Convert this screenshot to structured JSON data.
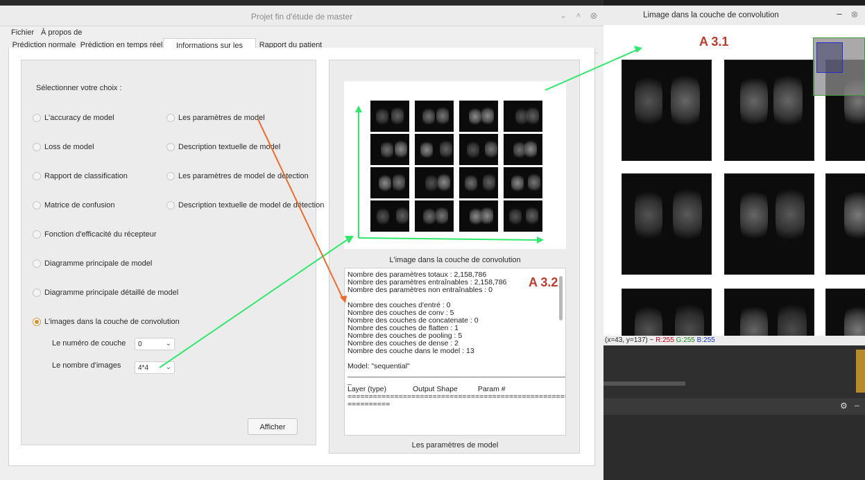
{
  "main_window": {
    "title": "Projet fin d'étude de master",
    "minimize_symbol": "⌄",
    "maximize_symbol": "˄",
    "close_symbol": "⊗",
    "menu": [
      "Fichier",
      "À propos de"
    ],
    "tabs": [
      "Prédiction normale",
      "Prédiction en temps réel",
      "Informations sur les modeles",
      "Rapport du patient"
    ],
    "active_tab_index": 2
  },
  "left_panel": {
    "prompt": "Sélectionner votre choix :",
    "options_col1": [
      "L'accuracy de model",
      "Loss de model",
      "Rapport de classification",
      "Matrice de confusion",
      "Fonction d'efficacité du récepteur",
      "Diagramme principale de model",
      "Diagramme principale détaillé de  model",
      "L'images dans la couche de convolution"
    ],
    "options_col2": [
      "Les paramètres de model",
      "Description textuelle de model",
      "Les paramètres de model de detection",
      "Description textuelle de model de détection"
    ],
    "selected_option": "L'images dans la couche de convolution",
    "layer_label": "Le numéro de couche",
    "layer_value": "0",
    "images_label": "Le nombre d'images",
    "images_value": "4*4",
    "display_button": "Afficher"
  },
  "right_panel": {
    "image_caption": "L'image dans la couche de convolution",
    "text_caption": "Les paramètres de model",
    "model_summary": "Nombre des paramètres totaux : 2,158,786\nNombre des paramètres entraînables : 2,158,786\nNombre des paramètres non entraînables : 0\n\nNombre des couches d'entré : 0\nNombre des couches de conv : 5\nNombre des couches de concatenate : 0\nNombre des couches de flatten : 1\nNombre des couches de pooling : 5\nNombre des couches de dense : 2\nNombre des couche dans le model : 13\n\nModel: \"sequential\"\n_______________________________________________________\n_\nLayer (type)             Output Shape          Param #\n=======================================================\n=========="
  },
  "annotations": {
    "a31": "A 3.1",
    "a32": "A 3.2",
    "arrow_green": "#2ee86b",
    "arrow_orange": "#f06a2a"
  },
  "viewer_window": {
    "title": "Limage dans la couche de convolution",
    "minimize_symbol": "–",
    "close_symbol": "⊗",
    "coords": "(x=43, y=137) ~",
    "r": "R:255",
    "g": "G:255",
    "b": "B:255",
    "gear_symbol": "⚙",
    "dash_symbol": "–"
  },
  "colors": {
    "accent_radio": "#e08a2c",
    "annotation_red": "#c0392b",
    "r_color": "#d0021b",
    "g_color": "#1a8a1a",
    "b_color": "#1a36d0"
  }
}
